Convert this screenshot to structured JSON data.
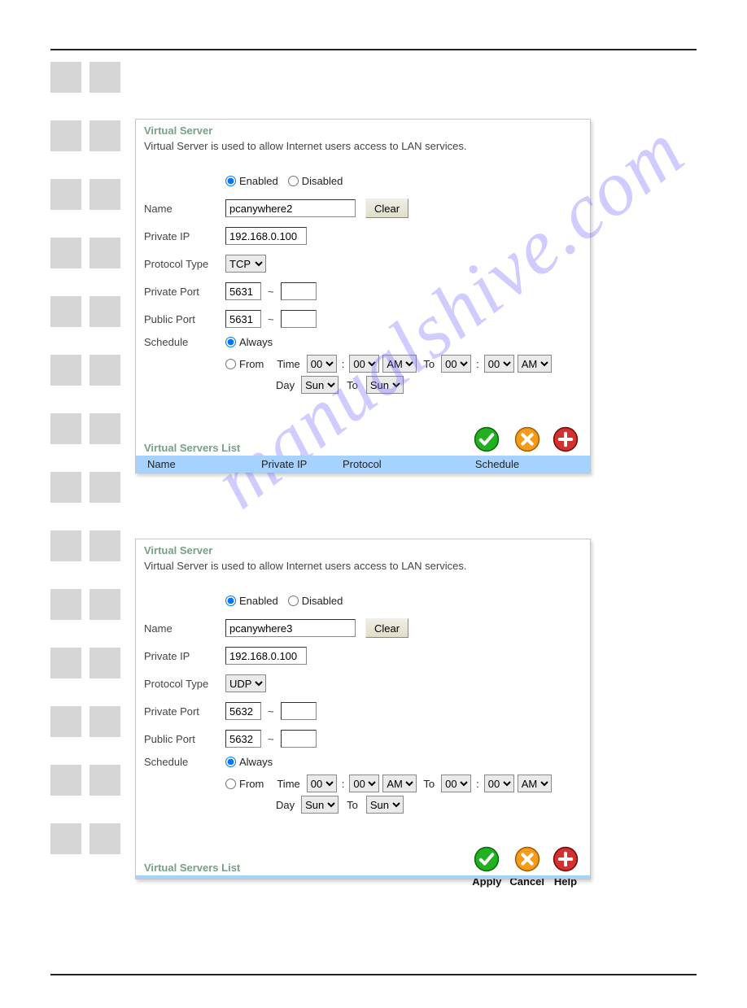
{
  "watermark": "manualshive.com",
  "labels": {
    "section_title": "Virtual Server",
    "section_desc": "Virtual Server is used to allow Internet users access to LAN services.",
    "enabled": "Enabled",
    "disabled": "Disabled",
    "name": "Name",
    "clear": "Clear",
    "private_ip": "Private IP",
    "protocol_type": "Protocol Type",
    "private_port": "Private Port",
    "public_port": "Public Port",
    "schedule": "Schedule",
    "always": "Always",
    "from": "From",
    "time": "Time",
    "to": "To",
    "day": "Day",
    "list_title": "Virtual Servers List",
    "col_name": "Name",
    "col_ip": "Private IP",
    "col_protocol": "Protocol",
    "col_schedule": "Schedule",
    "apply": "Apply",
    "cancel": "Cancel",
    "help": "Help"
  },
  "options": {
    "protocols": [
      "TCP",
      "UDP"
    ],
    "hours": [
      "00"
    ],
    "minutes": [
      "00"
    ],
    "ampm": [
      "AM"
    ],
    "days": [
      "Sun"
    ]
  },
  "panels": [
    {
      "status": "enabled",
      "name": "pcanywhere2",
      "private_ip": "192.168.0.100",
      "protocol": "TCP",
      "private_port_from": "5631",
      "private_port_to": "",
      "public_port_from": "5631",
      "public_port_to": "",
      "schedule_mode": "always",
      "from_hour": "00",
      "from_min": "00",
      "from_ampm": "AM",
      "to_hour": "00",
      "to_min": "00",
      "to_ampm": "AM",
      "day_from": "Sun",
      "day_to": "Sun",
      "show_list_columns": true
    },
    {
      "status": "enabled",
      "name": "pcanywhere3",
      "private_ip": "192.168.0.100",
      "protocol": "UDP",
      "private_port_from": "5632",
      "private_port_to": "",
      "public_port_from": "5632",
      "public_port_to": "",
      "schedule_mode": "always",
      "from_hour": "00",
      "from_min": "00",
      "from_ampm": "AM",
      "to_hour": "00",
      "to_min": "00",
      "to_ampm": "AM",
      "day_from": "Sun",
      "day_to": "Sun",
      "show_list_columns": false
    }
  ]
}
